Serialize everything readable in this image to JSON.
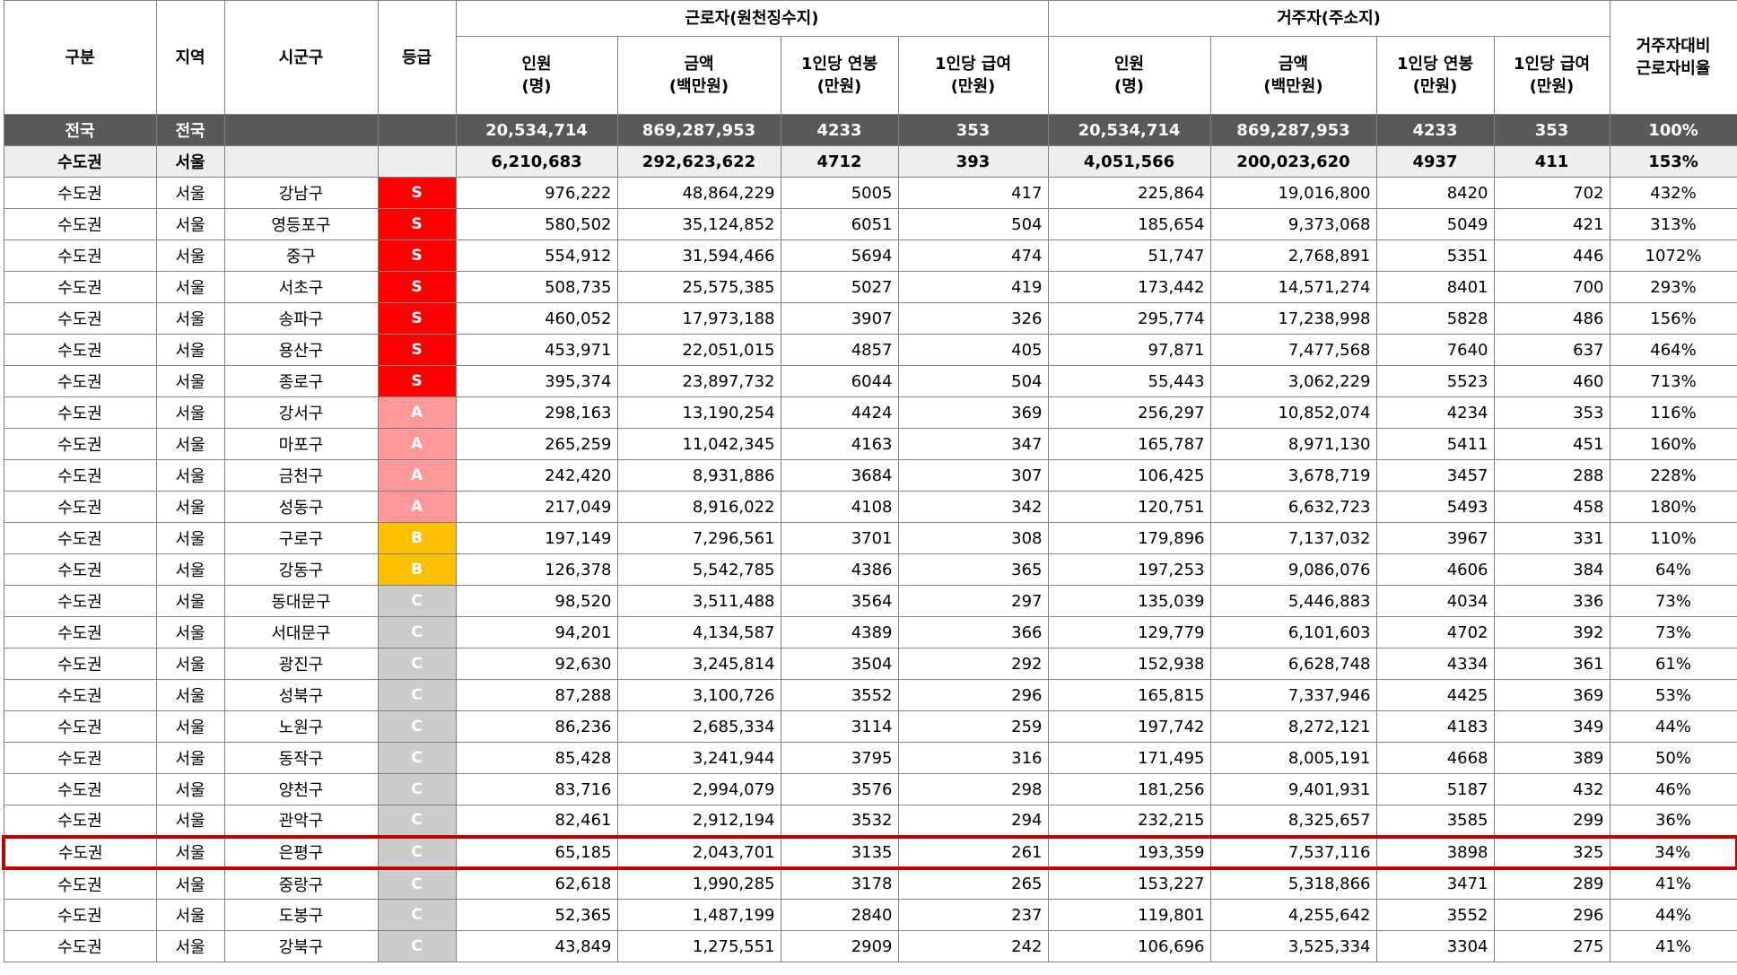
{
  "header": {
    "col_gubun": "구분",
    "col_region": "지역",
    "col_district": "시군구",
    "col_grade": "등급",
    "group_worker": "근로자(원천징수지)",
    "group_resident": "거주자(주소지)",
    "col_ratio_line1": "거주자대비",
    "col_ratio_line2": "근로자비율",
    "sub_count_line1": "인원",
    "sub_count_line2": "(명)",
    "sub_amount_line1": "금액",
    "sub_amount_line2": "(백만원)",
    "sub_salary_line1": "1인당 연봉",
    "sub_salary_line2": "(만원)",
    "sub_pay_line1": "1인당 급여",
    "sub_pay_line2": "(만원)"
  },
  "rows": [
    {
      "type": "national",
      "gubun": "전국",
      "region": "전국",
      "district": "",
      "grade": "",
      "w_count": "20,534,714",
      "w_amount": "869,287,953",
      "w_salary": "4233",
      "w_pay": "353",
      "r_count": "20,534,714",
      "r_amount": "869,287,953",
      "r_salary": "4233",
      "r_pay": "353",
      "ratio": "100%"
    },
    {
      "type": "regional",
      "gubun": "수도권",
      "region": "서울",
      "district": "",
      "grade": "",
      "w_count": "6,210,683",
      "w_amount": "292,623,622",
      "w_salary": "4712",
      "w_pay": "393",
      "r_count": "4,051,566",
      "r_amount": "200,023,620",
      "r_salary": "4937",
      "r_pay": "411",
      "ratio": "153%"
    },
    {
      "type": "data",
      "gubun": "수도권",
      "region": "서울",
      "district": "강남구",
      "grade": "S",
      "w_count": "976,222",
      "w_amount": "48,864,229",
      "w_salary": "5005",
      "w_pay": "417",
      "r_count": "225,864",
      "r_amount": "19,016,800",
      "r_salary": "8420",
      "r_pay": "702",
      "ratio": "432%"
    },
    {
      "type": "data",
      "gubun": "수도권",
      "region": "서울",
      "district": "영등포구",
      "grade": "S",
      "w_count": "580,502",
      "w_amount": "35,124,852",
      "w_salary": "6051",
      "w_pay": "504",
      "r_count": "185,654",
      "r_amount": "9,373,068",
      "r_salary": "5049",
      "r_pay": "421",
      "ratio": "313%"
    },
    {
      "type": "data",
      "gubun": "수도권",
      "region": "서울",
      "district": "중구",
      "grade": "S",
      "w_count": "554,912",
      "w_amount": "31,594,466",
      "w_salary": "5694",
      "w_pay": "474",
      "r_count": "51,747",
      "r_amount": "2,768,891",
      "r_salary": "5351",
      "r_pay": "446",
      "ratio": "1072%"
    },
    {
      "type": "data",
      "gubun": "수도권",
      "region": "서울",
      "district": "서초구",
      "grade": "S",
      "w_count": "508,735",
      "w_amount": "25,575,385",
      "w_salary": "5027",
      "w_pay": "419",
      "r_count": "173,442",
      "r_amount": "14,571,274",
      "r_salary": "8401",
      "r_pay": "700",
      "ratio": "293%"
    },
    {
      "type": "data",
      "gubun": "수도권",
      "region": "서울",
      "district": "송파구",
      "grade": "S",
      "w_count": "460,052",
      "w_amount": "17,973,188",
      "w_salary": "3907",
      "w_pay": "326",
      "r_count": "295,774",
      "r_amount": "17,238,998",
      "r_salary": "5828",
      "r_pay": "486",
      "ratio": "156%"
    },
    {
      "type": "data",
      "gubun": "수도권",
      "region": "서울",
      "district": "용산구",
      "grade": "S",
      "w_count": "453,971",
      "w_amount": "22,051,015",
      "w_salary": "4857",
      "w_pay": "405",
      "r_count": "97,871",
      "r_amount": "7,477,568",
      "r_salary": "7640",
      "r_pay": "637",
      "ratio": "464%"
    },
    {
      "type": "data",
      "gubun": "수도권",
      "region": "서울",
      "district": "종로구",
      "grade": "S",
      "w_count": "395,374",
      "w_amount": "23,897,732",
      "w_salary": "6044",
      "w_pay": "504",
      "r_count": "55,443",
      "r_amount": "3,062,229",
      "r_salary": "5523",
      "r_pay": "460",
      "ratio": "713%"
    },
    {
      "type": "data",
      "gubun": "수도권",
      "region": "서울",
      "district": "강서구",
      "grade": "A",
      "w_count": "298,163",
      "w_amount": "13,190,254",
      "w_salary": "4424",
      "w_pay": "369",
      "r_count": "256,297",
      "r_amount": "10,852,074",
      "r_salary": "4234",
      "r_pay": "353",
      "ratio": "116%"
    },
    {
      "type": "data",
      "gubun": "수도권",
      "region": "서울",
      "district": "마포구",
      "grade": "A",
      "w_count": "265,259",
      "w_amount": "11,042,345",
      "w_salary": "4163",
      "w_pay": "347",
      "r_count": "165,787",
      "r_amount": "8,971,130",
      "r_salary": "5411",
      "r_pay": "451",
      "ratio": "160%"
    },
    {
      "type": "data",
      "gubun": "수도권",
      "region": "서울",
      "district": "금천구",
      "grade": "A",
      "w_count": "242,420",
      "w_amount": "8,931,886",
      "w_salary": "3684",
      "w_pay": "307",
      "r_count": "106,425",
      "r_amount": "3,678,719",
      "r_salary": "3457",
      "r_pay": "288",
      "ratio": "228%"
    },
    {
      "type": "data",
      "gubun": "수도권",
      "region": "서울",
      "district": "성동구",
      "grade": "A",
      "w_count": "217,049",
      "w_amount": "8,916,022",
      "w_salary": "4108",
      "w_pay": "342",
      "r_count": "120,751",
      "r_amount": "6,632,723",
      "r_salary": "5493",
      "r_pay": "458",
      "ratio": "180%"
    },
    {
      "type": "data",
      "gubun": "수도권",
      "region": "서울",
      "district": "구로구",
      "grade": "B",
      "w_count": "197,149",
      "w_amount": "7,296,561",
      "w_salary": "3701",
      "w_pay": "308",
      "r_count": "179,896",
      "r_amount": "7,137,032",
      "r_salary": "3967",
      "r_pay": "331",
      "ratio": "110%"
    },
    {
      "type": "data",
      "gubun": "수도권",
      "region": "서울",
      "district": "강동구",
      "grade": "B",
      "w_count": "126,378",
      "w_amount": "5,542,785",
      "w_salary": "4386",
      "w_pay": "365",
      "r_count": "197,253",
      "r_amount": "9,086,076",
      "r_salary": "4606",
      "r_pay": "384",
      "ratio": "64%"
    },
    {
      "type": "data",
      "gubun": "수도권",
      "region": "서울",
      "district": "동대문구",
      "grade": "C",
      "w_count": "98,520",
      "w_amount": "3,511,488",
      "w_salary": "3564",
      "w_pay": "297",
      "r_count": "135,039",
      "r_amount": "5,446,883",
      "r_salary": "4034",
      "r_pay": "336",
      "ratio": "73%"
    },
    {
      "type": "data",
      "gubun": "수도권",
      "region": "서울",
      "district": "서대문구",
      "grade": "C",
      "w_count": "94,201",
      "w_amount": "4,134,587",
      "w_salary": "4389",
      "w_pay": "366",
      "r_count": "129,779",
      "r_amount": "6,101,603",
      "r_salary": "4702",
      "r_pay": "392",
      "ratio": "73%"
    },
    {
      "type": "data",
      "gubun": "수도권",
      "region": "서울",
      "district": "광진구",
      "grade": "C",
      "w_count": "92,630",
      "w_amount": "3,245,814",
      "w_salary": "3504",
      "w_pay": "292",
      "r_count": "152,938",
      "r_amount": "6,628,748",
      "r_salary": "4334",
      "r_pay": "361",
      "ratio": "61%"
    },
    {
      "type": "data",
      "gubun": "수도권",
      "region": "서울",
      "district": "성북구",
      "grade": "C",
      "w_count": "87,288",
      "w_amount": "3,100,726",
      "w_salary": "3552",
      "w_pay": "296",
      "r_count": "165,815",
      "r_amount": "7,337,946",
      "r_salary": "4425",
      "r_pay": "369",
      "ratio": "53%"
    },
    {
      "type": "data",
      "gubun": "수도권",
      "region": "서울",
      "district": "노원구",
      "grade": "C",
      "w_count": "86,236",
      "w_amount": "2,685,334",
      "w_salary": "3114",
      "w_pay": "259",
      "r_count": "197,742",
      "r_amount": "8,272,121",
      "r_salary": "4183",
      "r_pay": "349",
      "ratio": "44%"
    },
    {
      "type": "data",
      "gubun": "수도권",
      "region": "서울",
      "district": "동작구",
      "grade": "C",
      "w_count": "85,428",
      "w_amount": "3,241,944",
      "w_salary": "3795",
      "w_pay": "316",
      "r_count": "171,495",
      "r_amount": "8,005,191",
      "r_salary": "4668",
      "r_pay": "389",
      "ratio": "50%"
    },
    {
      "type": "data",
      "gubun": "수도권",
      "region": "서울",
      "district": "양천구",
      "grade": "C",
      "w_count": "83,716",
      "w_amount": "2,994,079",
      "w_salary": "3576",
      "w_pay": "298",
      "r_count": "181,256",
      "r_amount": "9,401,931",
      "r_salary": "5187",
      "r_pay": "432",
      "ratio": "46%"
    },
    {
      "type": "data",
      "gubun": "수도권",
      "region": "서울",
      "district": "관악구",
      "grade": "C",
      "w_count": "82,461",
      "w_amount": "2,912,194",
      "w_salary": "3532",
      "w_pay": "294",
      "r_count": "232,215",
      "r_amount": "8,325,657",
      "r_salary": "3585",
      "r_pay": "299",
      "ratio": "36%"
    },
    {
      "type": "highlight",
      "gubun": "수도권",
      "region": "서울",
      "district": "은평구",
      "grade": "C",
      "w_count": "65,185",
      "w_amount": "2,043,701",
      "w_salary": "3135",
      "w_pay": "261",
      "r_count": "193,359",
      "r_amount": "7,537,116",
      "r_salary": "3898",
      "r_pay": "325",
      "ratio": "34%"
    },
    {
      "type": "data",
      "gubun": "수도권",
      "region": "서울",
      "district": "중랑구",
      "grade": "C",
      "w_count": "62,618",
      "w_amount": "1,990,285",
      "w_salary": "3178",
      "w_pay": "265",
      "r_count": "153,227",
      "r_amount": "5,318,866",
      "r_salary": "3471",
      "r_pay": "289",
      "ratio": "41%"
    },
    {
      "type": "data",
      "gubun": "수도권",
      "region": "서울",
      "district": "도봉구",
      "grade": "C",
      "w_count": "52,365",
      "w_amount": "1,487,199",
      "w_salary": "2840",
      "w_pay": "237",
      "r_count": "119,801",
      "r_amount": "4,255,642",
      "r_salary": "3552",
      "r_pay": "296",
      "ratio": "44%"
    },
    {
      "type": "data",
      "gubun": "수도권",
      "region": "서울",
      "district": "강북구",
      "grade": "C",
      "w_count": "43,849",
      "w_amount": "1,275,551",
      "w_salary": "2909",
      "w_pay": "242",
      "r_count": "106,696",
      "r_amount": "3,525,334",
      "r_salary": "3304",
      "r_pay": "275",
      "ratio": "41%"
    }
  ],
  "colors": {
    "grade_S": "#ff0000",
    "grade_A": "#ff9999",
    "grade_B": "#ffc000",
    "grade_C": "#cccccc",
    "national_row_bg": "#595959",
    "regional_row_bg": "#eeeeee",
    "highlight_border": "#c00000"
  }
}
